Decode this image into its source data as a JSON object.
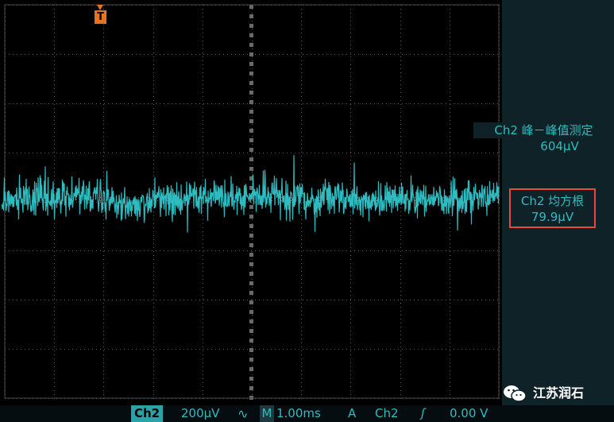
{
  "scope": {
    "trigger_marker": "T",
    "channel_color": "#2fbcc0",
    "measurements": {
      "peak_to_peak": {
        "title": "Ch2 峰－峰值测定",
        "value": "604µV"
      },
      "rms": {
        "title": "Ch2 均方根",
        "value": "79.9µV"
      }
    },
    "status_bar": {
      "channel": "Ch2",
      "scale": "200µV",
      "coupling_icon": "∿",
      "timebase_mode": "M",
      "timebase": "1.00ms",
      "trigger_mode": "A",
      "trigger_channel": "Ch2",
      "trigger_slope": "ʃ",
      "trigger_level": "0.00 V"
    }
  },
  "watermark": {
    "icon": "wechat-icon",
    "text": "江苏润石"
  },
  "colors": {
    "trace": "#2fbcc0",
    "trigger": "#e8731a",
    "highlight_box": "#e8483a",
    "screen_bg": "#000000"
  }
}
